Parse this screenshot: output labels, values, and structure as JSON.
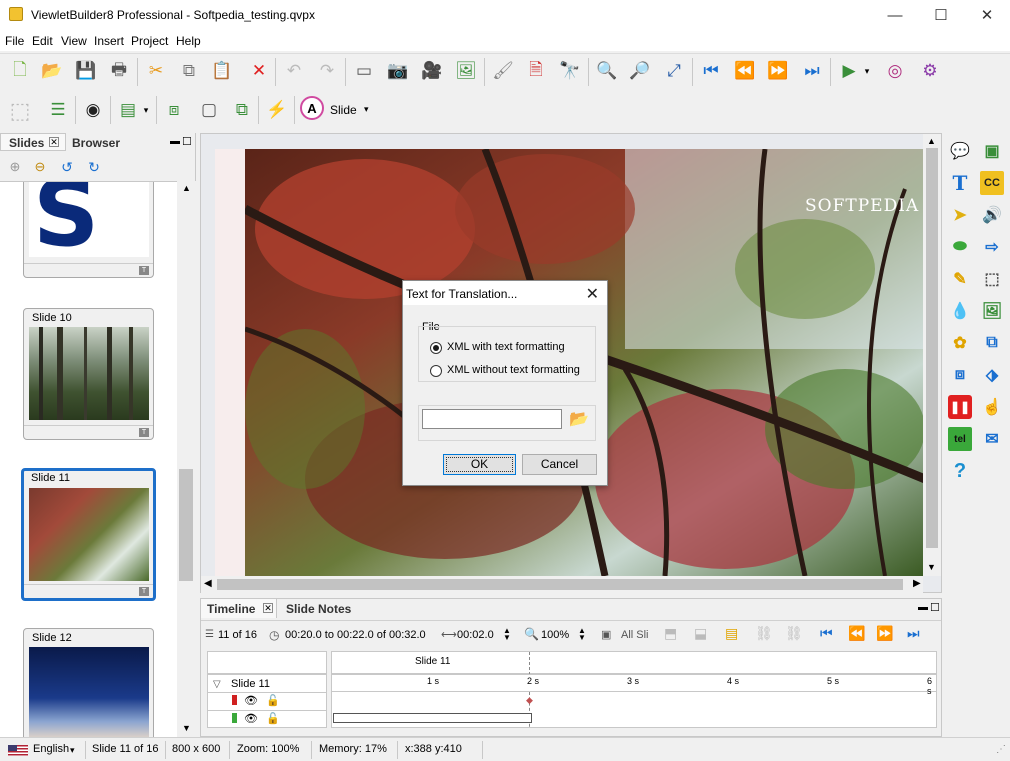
{
  "window": {
    "title": "ViewletBuilder8 Professional - Softpedia_testing.qvpx",
    "minimize": "—",
    "maximize": "☐",
    "close": "✕"
  },
  "menu": [
    "File",
    "Edit",
    "View",
    "Insert",
    "Project",
    "Help"
  ],
  "toolbar2": {
    "slide_label": "Slide"
  },
  "left_panel": {
    "tabs": [
      "Slides",
      "Browser"
    ],
    "slides": [
      {
        "label": ""
      },
      {
        "label": "Slide 10"
      },
      {
        "label": "Slide 11"
      },
      {
        "label": "Slide 12"
      }
    ]
  },
  "canvas": {
    "watermark": "SOFTPEDIA"
  },
  "dialog": {
    "title": "Text for Translation...",
    "group_label": "File",
    "option1": "XML with text formatting",
    "option2": "XML without text formatting",
    "file_value": "",
    "ok": "OK",
    "cancel": "Cancel"
  },
  "timeline": {
    "tabs": [
      "Timeline",
      "Slide Notes"
    ],
    "position": "11 of 16",
    "time_range": "00:20.0 to 00:22.0 of 00:32.0",
    "duration": "00:02.0",
    "zoom": "100%",
    "all_slides": "All Sli",
    "header_slide": "Slide 11",
    "row_slide": "Slide 11",
    "ticks": [
      "1 s",
      "2 s",
      "3 s",
      "4 s",
      "5 s",
      "6 s"
    ]
  },
  "statusbar": {
    "language": "English",
    "slide": "Slide 11 of 16",
    "size": "800 x 600",
    "zoom": "Zoom: 100%",
    "memory": "Memory: 17%",
    "coords": "x:388 y:410"
  },
  "colors": {
    "accent": "#1e6fc9",
    "selection": "#1e6fc9"
  }
}
